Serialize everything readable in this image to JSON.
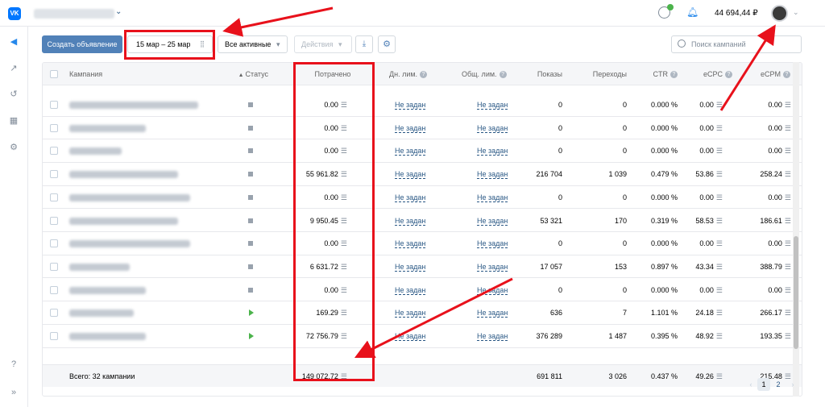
{
  "header": {
    "logo": "VK",
    "balance": "44 694,44 ₽"
  },
  "toolbar": {
    "create_label": "Создать объявление",
    "date_range": "15 мар – 25 мар",
    "filter_label": "Все активные",
    "actions_label": "Действия",
    "search_placeholder": "Поиск кампаний"
  },
  "table": {
    "columns": {
      "campaign": "Кампания",
      "status": "Статус",
      "spent": "Потрачено",
      "daily_limit": "Дн. лим.",
      "total_limit": "Общ. лим.",
      "impressions": "Показы",
      "clicks": "Переходы",
      "ctr": "CTR",
      "ecpc": "eCPC",
      "ecpm": "eCPM"
    },
    "rows": [
      {
        "status": "stopped",
        "spent": "0.00",
        "daily": "Не задан",
        "total": "Не задан",
        "impressions": "0",
        "clicks": "0",
        "ctr": "0.000 %",
        "ecpc": "0.00",
        "ecpm": "0.00"
      },
      {
        "status": "stopped",
        "spent": "0.00",
        "daily": "Не задан",
        "total": "Не задан",
        "impressions": "0",
        "clicks": "0",
        "ctr": "0.000 %",
        "ecpc": "0.00",
        "ecpm": "0.00"
      },
      {
        "status": "stopped",
        "spent": "0.00",
        "daily": "Не задан",
        "total": "Не задан",
        "impressions": "0",
        "clicks": "0",
        "ctr": "0.000 %",
        "ecpc": "0.00",
        "ecpm": "0.00"
      },
      {
        "status": "stopped",
        "spent": "55 961.82",
        "daily": "Не задан",
        "total": "Не задан",
        "impressions": "216 704",
        "clicks": "1 039",
        "ctr": "0.479 %",
        "ecpc": "53.86",
        "ecpm": "258.24"
      },
      {
        "status": "stopped",
        "spent": "0.00",
        "daily": "Не задан",
        "total": "Не задан",
        "impressions": "0",
        "clicks": "0",
        "ctr": "0.000 %",
        "ecpc": "0.00",
        "ecpm": "0.00"
      },
      {
        "status": "stopped",
        "spent": "9 950.45",
        "daily": "Не задан",
        "total": "Не задан",
        "impressions": "53 321",
        "clicks": "170",
        "ctr": "0.319 %",
        "ecpc": "58.53",
        "ecpm": "186.61"
      },
      {
        "status": "stopped",
        "spent": "0.00",
        "daily": "Не задан",
        "total": "Не задан",
        "impressions": "0",
        "clicks": "0",
        "ctr": "0.000 %",
        "ecpc": "0.00",
        "ecpm": "0.00"
      },
      {
        "status": "stopped",
        "spent": "6 631.72",
        "daily": "Не задан",
        "total": "Не задан",
        "impressions": "17 057",
        "clicks": "153",
        "ctr": "0.897 %",
        "ecpc": "43.34",
        "ecpm": "388.79"
      },
      {
        "status": "stopped",
        "spent": "0.00",
        "daily": "Не задан",
        "total": "Не задан",
        "impressions": "0",
        "clicks": "0",
        "ctr": "0.000 %",
        "ecpc": "0.00",
        "ecpm": "0.00"
      },
      {
        "status": "active",
        "spent": "169.29",
        "daily": "Не задан",
        "total": "Не задан",
        "impressions": "636",
        "clicks": "7",
        "ctr": "1.101 %",
        "ecpc": "24.18",
        "ecpm": "266.17"
      },
      {
        "status": "active",
        "spent": "72 756.79",
        "daily": "Не задан",
        "total": "Не задан",
        "impressions": "376 289",
        "clicks": "1 487",
        "ctr": "0.395 %",
        "ecpc": "48.92",
        "ecpm": "193.35"
      }
    ],
    "total": {
      "label": "Всего: 32 кампании",
      "spent": "149 072.72",
      "impressions": "691 811",
      "clicks": "3 026",
      "ctr": "0.437 %",
      "ecpc": "49.26",
      "ecpm": "215.48"
    },
    "question_glyph": "?",
    "equals_glyph": "☰"
  },
  "pagination": {
    "page1": "1",
    "page2": "2",
    "prev": "‹",
    "next": "›"
  },
  "colors": {
    "accent": "#5181b8",
    "link": "#2a5885",
    "annotation": "#e8111b",
    "active_status": "#4bb34b"
  }
}
